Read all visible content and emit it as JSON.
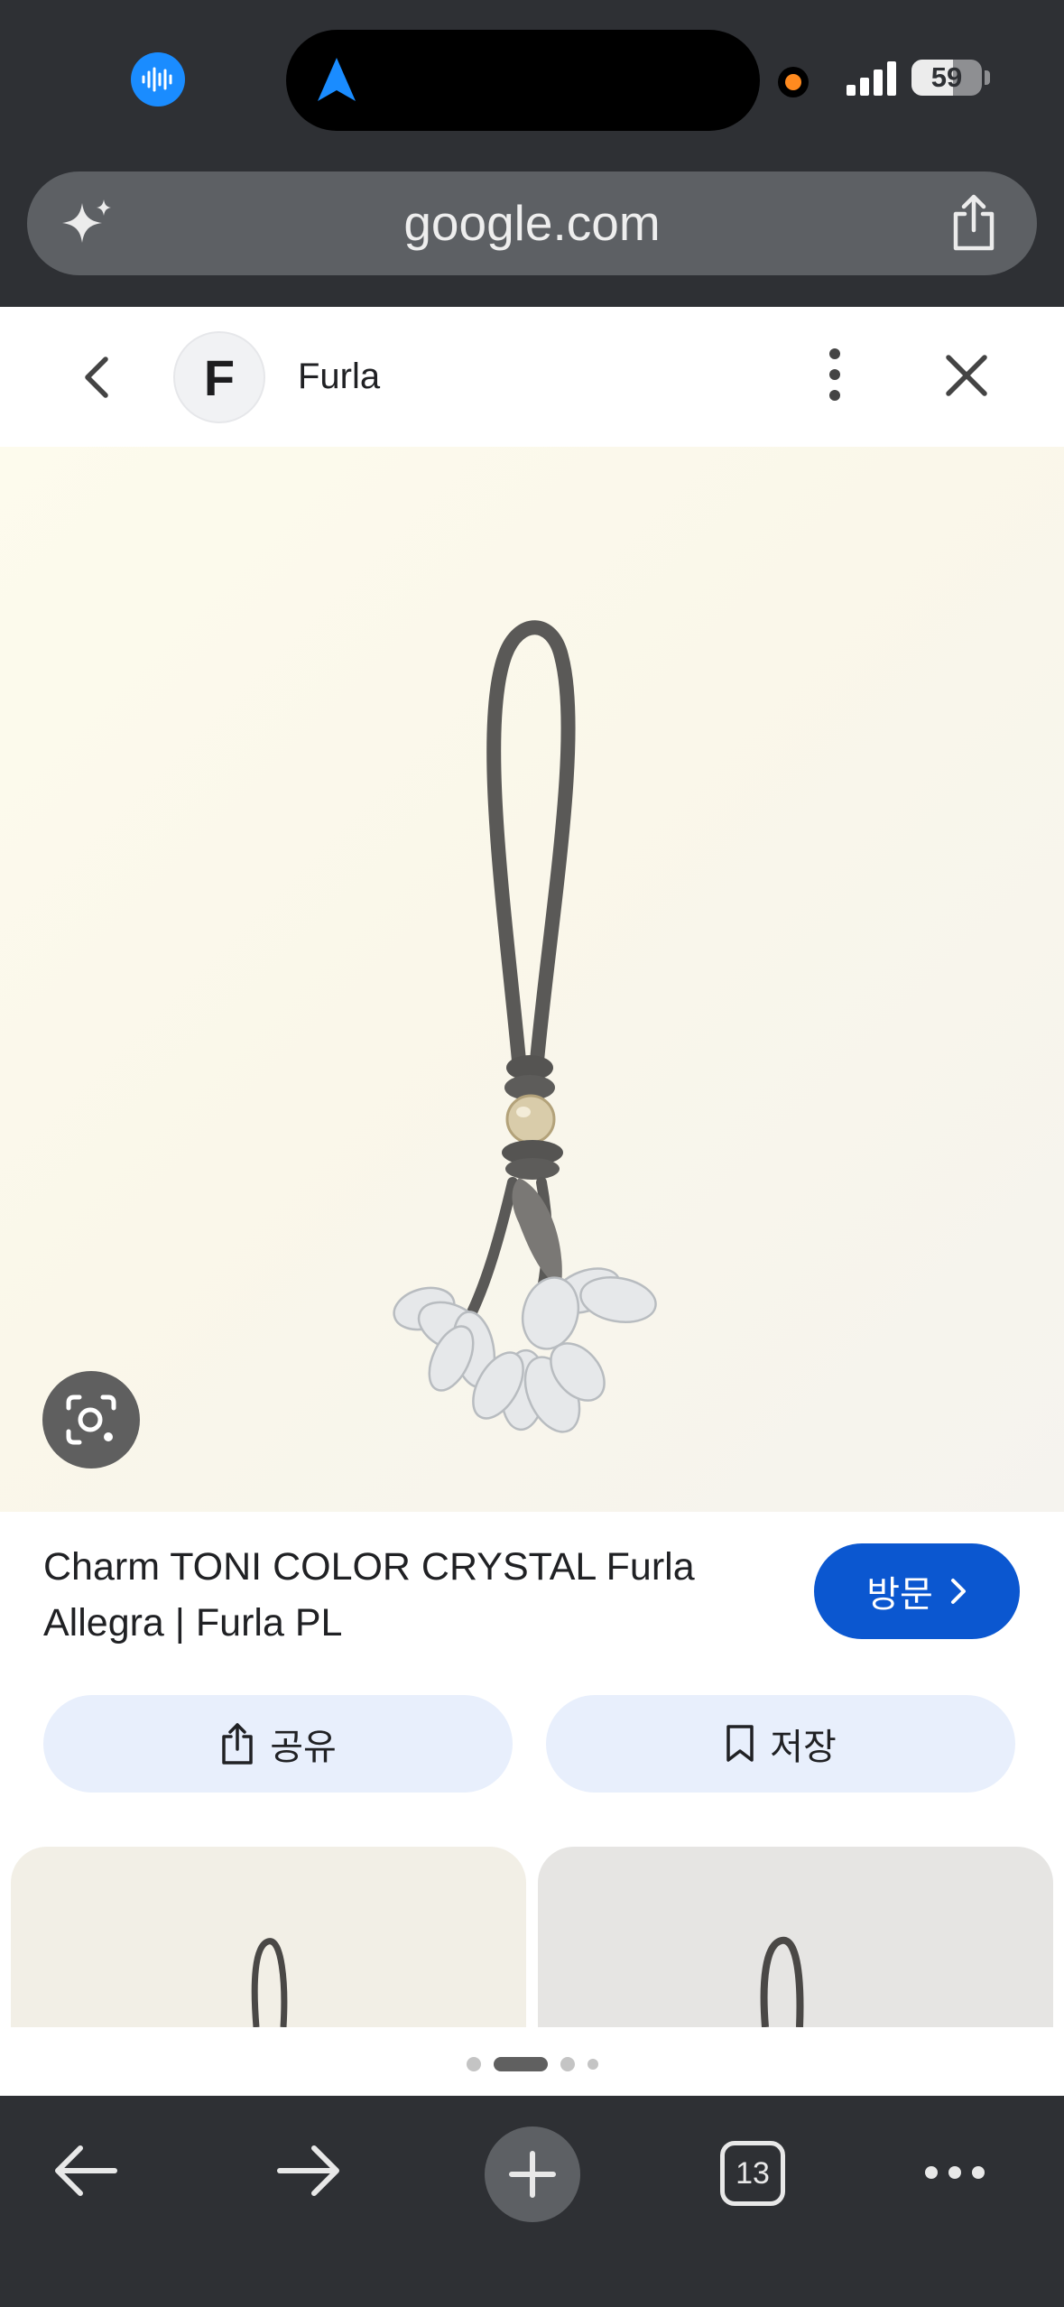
{
  "status_bar": {
    "battery_level": "59",
    "colors": {
      "voice_icon": "#1a8cff",
      "recording_dot": "#ff8a1f",
      "nav_arrow": "#1a8cff"
    }
  },
  "browser": {
    "url": "google.com",
    "tab_count": "13"
  },
  "viewer": {
    "site_initial": "F",
    "site_name": "Furla",
    "result_title": "Charm TONI COLOR CRYSTAL Furla Allegra | Furla PL",
    "visit_label": "방문",
    "share_label": "공유",
    "save_label": "저장",
    "carousel": {
      "count": 4,
      "active_index": 1
    },
    "colors": {
      "accent": "#0b57d0",
      "pill_bg": "#e8effc"
    }
  }
}
